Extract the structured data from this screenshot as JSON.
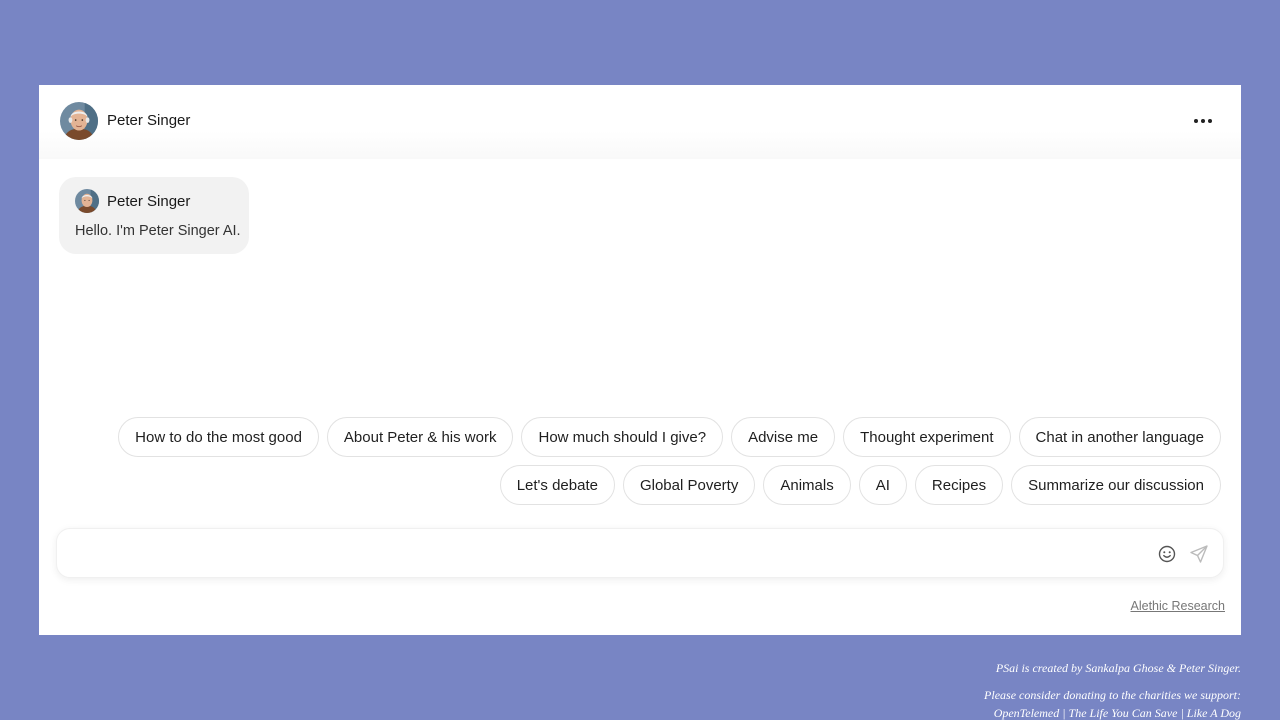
{
  "header": {
    "name": "Peter Singer",
    "more_icon": "more-horizontal-icon"
  },
  "messages": [
    {
      "sender": "Peter Singer",
      "text": "Hello. I'm Peter Singer AI."
    }
  ],
  "suggestions": {
    "row1": [
      "How to do the most good",
      "About Peter & his work",
      "How much should I give?",
      "Advise me",
      "Thought experiment",
      "Chat in another language"
    ],
    "row2": [
      "Let's debate",
      "Global Poverty",
      "Animals",
      "AI",
      "Recipes",
      "Summarize our discussion"
    ]
  },
  "composer": {
    "value": "",
    "placeholder": "",
    "emoji_icon": "smiley-icon",
    "send_icon": "send-icon"
  },
  "brand_link": "Alethic Research",
  "footer": {
    "credit": "PSai is created by Sankalpa Ghose & Peter Singer.",
    "donate_intro": "Please consider donating to the charities we support:",
    "charities": [
      "OpenTelemed",
      "The Life You Can Save",
      "Like A Dog"
    ],
    "separator": " | "
  },
  "colors": {
    "background": "#7885c4",
    "panel": "#ffffff",
    "bubble": "#f2f2f2",
    "chip_border": "#e2e2e2"
  }
}
